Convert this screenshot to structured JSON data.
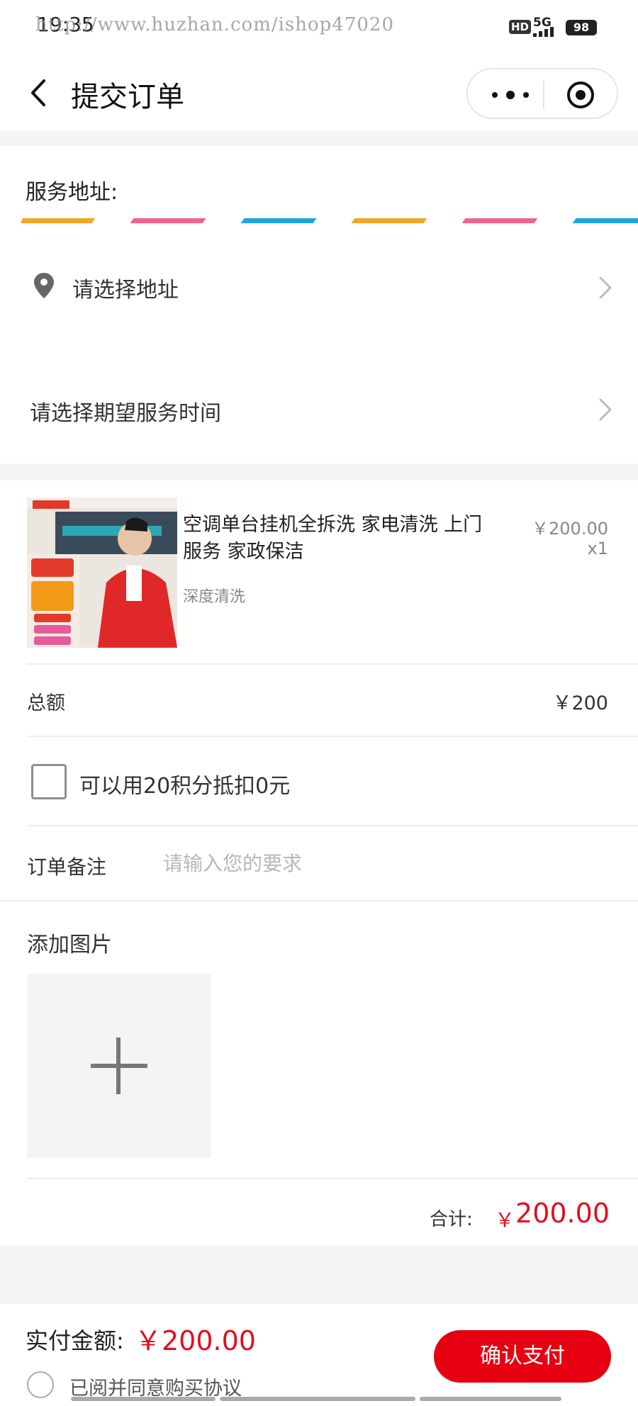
{
  "status_bar": {
    "time": "19:35",
    "watermark": "http://www.huzhan.com/ishop47020",
    "hd_badge": "HD",
    "network": "5G",
    "battery": "98"
  },
  "nav": {
    "title": "提交订单",
    "back_icon": "chevron-left-icon",
    "more_icon": "more-dots-icon",
    "close_icon": "target-circle-icon"
  },
  "address": {
    "heading": "服务地址:",
    "stripe_colors": [
      "#f5a623",
      "#f06292",
      "#1aa7e0",
      "#f5a623",
      "#f06292",
      "#1aa7e0"
    ],
    "select_address_label": "请选择地址",
    "select_time_label": "请选择期望服务时间"
  },
  "product": {
    "name": "空调单台挂机全拆洗 家电清洗 上门服务 家政保洁",
    "spec": "深度清洗",
    "price": "￥200.00",
    "quantity": "x1"
  },
  "summary": {
    "total_label": "总额",
    "total_value": "￥200",
    "points_label": "可以用20积分抵扣0元",
    "points_checked": false
  },
  "remark": {
    "label": "订单备注",
    "placeholder": "请输入您的要求",
    "value": ""
  },
  "images": {
    "heading": "添加图片",
    "add_icon": "plus-icon"
  },
  "subtotal": {
    "label": "合计:",
    "currency": "￥",
    "value": "200.00"
  },
  "footer": {
    "pay_label": "实付金额:",
    "pay_value": "￥200.00",
    "agree_label": "已阅并同意购买协议",
    "agree_checked": false,
    "confirm_label": "确认支付"
  },
  "colors": {
    "accent_red": "#e60012",
    "price_red": "#e10f1e",
    "background_gray": "#f5f5f5"
  }
}
